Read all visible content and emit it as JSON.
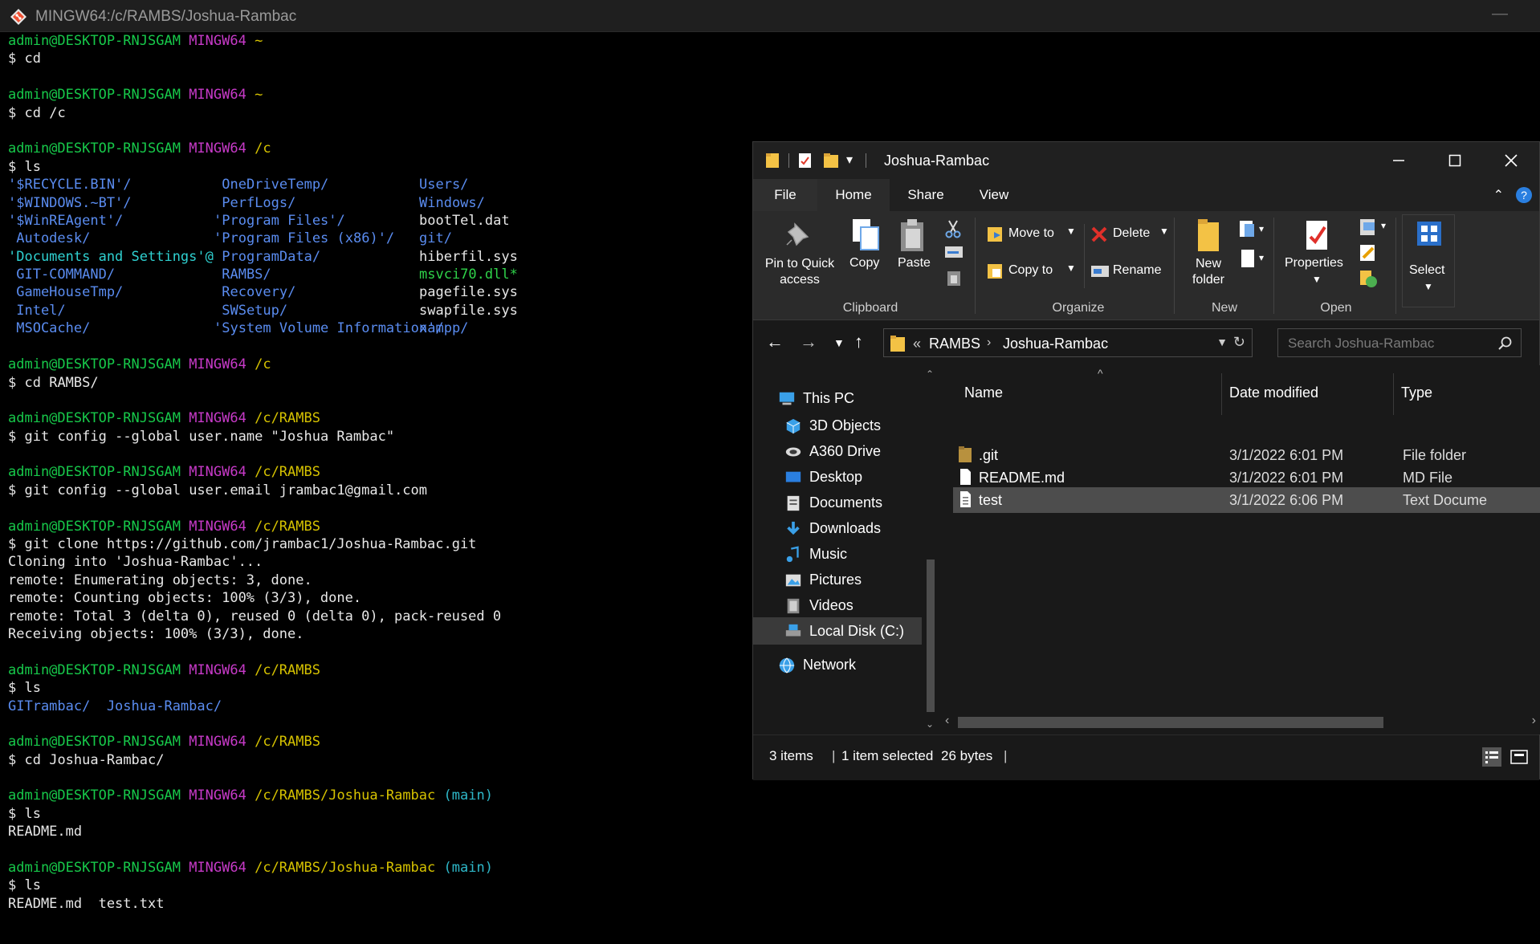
{
  "terminal": {
    "title": "MINGW64:/c/RAMBS/Joshua-Rambac",
    "minimize_glyph": "—",
    "prompt_user": "admin@DESKTOP-RNJSGAM",
    "prompt_env": "MINGW64",
    "prompt_sign": "$",
    "blocks": [
      {
        "path": "~",
        "branch": "",
        "cmd": "cd",
        "out": []
      },
      {
        "path": "~",
        "branch": "",
        "cmd": "cd /c",
        "out": []
      },
      {
        "path": "/c",
        "branch": "",
        "cmd": "ls",
        "out": []
      },
      {
        "path": "/c",
        "branch": "",
        "cmd": "cd RAMBS/",
        "out": []
      },
      {
        "path": "/c/RAMBS",
        "branch": "",
        "cmd": "git config --global user.name \"Joshua Rambac\"",
        "out": []
      },
      {
        "path": "/c/RAMBS",
        "branch": "",
        "cmd": "git config --global user.email jrambac1@gmail.com",
        "out": []
      },
      {
        "path": "/c/RAMBS",
        "branch": "",
        "cmd": "git clone https://github.com/jrambac1/Joshua-Rambac.git",
        "out": [
          "Cloning into 'Joshua-Rambac'...",
          "remote: Enumerating objects: 3, done.",
          "remote: Counting objects: 100% (3/3), done.",
          "remote: Total 3 (delta 0), reused 0 (delta 0), pack-reused 0",
          "Receiving objects: 100% (3/3), done."
        ]
      },
      {
        "path": "/c/RAMBS",
        "branch": "",
        "cmd": "ls",
        "out": []
      },
      {
        "path": "/c/RAMBS",
        "branch": "",
        "cmd": "cd Joshua-Rambac/",
        "out": []
      },
      {
        "path": "/c/RAMBS/Joshua-Rambac",
        "branch": "(main)",
        "cmd": "ls",
        "out": [
          "README.md"
        ]
      },
      {
        "path": "/c/RAMBS/Joshua-Rambac",
        "branch": "(main)",
        "cmd": "ls",
        "out": [
          "README.md  test.txt"
        ]
      }
    ],
    "ls_c": {
      "col1": [
        {
          "t": "'$RECYCLE.BIN'/",
          "k": "dir"
        },
        {
          "t": "'$WINDOWS.~BT'/",
          "k": "dir"
        },
        {
          "t": "'$WinREAgent'/",
          "k": "dir"
        },
        {
          "t": " Autodesk/",
          "k": "dir"
        },
        {
          "t": "'Documents and Settings'@",
          "k": "link"
        },
        {
          "t": " GIT-COMMAND/",
          "k": "dir"
        },
        {
          "t": " GameHouseTmp/",
          "k": "dir"
        },
        {
          "t": " Intel/",
          "k": "dir"
        },
        {
          "t": " MSOCache/",
          "k": "dir"
        }
      ],
      "col2": [
        {
          "t": " OneDriveTemp/",
          "k": "dir"
        },
        {
          "t": " PerfLogs/",
          "k": "dir"
        },
        {
          "t": "'Program Files'/",
          "k": "dir"
        },
        {
          "t": "'Program Files (x86)'/",
          "k": "dir"
        },
        {
          "t": " ProgramData/",
          "k": "dir"
        },
        {
          "t": " RAMBS/",
          "k": "dir"
        },
        {
          "t": " Recovery/",
          "k": "dir"
        },
        {
          "t": " SWSetup/",
          "k": "dir"
        },
        {
          "t": "'System Volume Information'/",
          "k": "dir"
        }
      ],
      "col3": [
        {
          "t": "Users/",
          "k": "dir"
        },
        {
          "t": "Windows/",
          "k": "dir"
        },
        {
          "t": "bootTel.dat",
          "k": "file"
        },
        {
          "t": "git/",
          "k": "dir"
        },
        {
          "t": "hiberfil.sys",
          "k": "file"
        },
        {
          "t": "msvci70.dll*",
          "k": "exec"
        },
        {
          "t": "pagefile.sys",
          "k": "file"
        },
        {
          "t": "swapfile.sys",
          "k": "file"
        },
        {
          "t": "xampp/",
          "k": "dir"
        }
      ]
    },
    "ls_rambs": "GITrambac/  Joshua-Rambac/"
  },
  "explorer": {
    "title": "Joshua-Rambac",
    "tabs": {
      "file": "File",
      "home": "Home",
      "share": "Share",
      "view": "View"
    },
    "ribbon": {
      "pin_to_quick_access": "Pin to Quick\naccess",
      "copy": "Copy",
      "paste": "Paste",
      "clipboard": "Clipboard",
      "move_to": "Move to",
      "copy_to": "Copy to",
      "delete": "Delete",
      "rename": "Rename",
      "organize": "Organize",
      "new_folder": "New\nfolder",
      "new": "New",
      "properties": "Properties",
      "open": "Open",
      "select": "Select"
    },
    "address": {
      "prefix": "«",
      "crumbs": [
        "RAMBS",
        "Joshua-Rambac"
      ]
    },
    "search_placeholder": "Search Joshua-Rambac",
    "nav": [
      {
        "label": "This PC",
        "icon": "this-pc-icon"
      },
      {
        "label": "3D Objects",
        "icon": "3d-objects-icon"
      },
      {
        "label": "A360 Drive",
        "icon": "a360-drive-icon"
      },
      {
        "label": "Desktop",
        "icon": "desktop-icon"
      },
      {
        "label": "Documents",
        "icon": "documents-icon"
      },
      {
        "label": "Downloads",
        "icon": "downloads-icon"
      },
      {
        "label": "Music",
        "icon": "music-icon"
      },
      {
        "label": "Pictures",
        "icon": "pictures-icon"
      },
      {
        "label": "Videos",
        "icon": "videos-icon"
      },
      {
        "label": "Local Disk (C:)",
        "icon": "local-disk-icon"
      },
      {
        "label": "Network",
        "icon": "network-icon"
      }
    ],
    "columns": {
      "name": "Name",
      "date": "Date modified",
      "type": "Type"
    },
    "files": [
      {
        "name": ".git",
        "date": "3/1/2022 6:01 PM",
        "type": "File folder",
        "icon": "folder-icon",
        "selected": false
      },
      {
        "name": "README.md",
        "date": "3/1/2022 6:01 PM",
        "type": "MD File",
        "icon": "file-icon",
        "selected": false
      },
      {
        "name": "test",
        "date": "3/1/2022 6:06 PM",
        "type": "Text Docume",
        "icon": "text-file-icon",
        "selected": true
      }
    ],
    "status": {
      "items": "3 items",
      "selected": "1 item selected",
      "size": "26 bytes"
    }
  }
}
